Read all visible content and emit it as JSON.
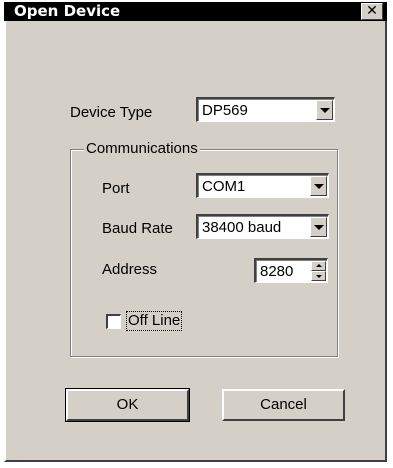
{
  "window": {
    "title": "Open Device",
    "close_glyph": "✕"
  },
  "device_type": {
    "label": "Device Type",
    "value": "DP569"
  },
  "communications": {
    "group_label": "Communications",
    "port": {
      "label": "Port",
      "value": "COM1"
    },
    "baud_rate": {
      "label": "Baud Rate",
      "value": "38400 baud"
    },
    "address": {
      "label": "Address",
      "value": "8280"
    },
    "offline": {
      "label": "Off Line",
      "checked": false
    }
  },
  "buttons": {
    "ok": "OK",
    "cancel": "Cancel"
  }
}
